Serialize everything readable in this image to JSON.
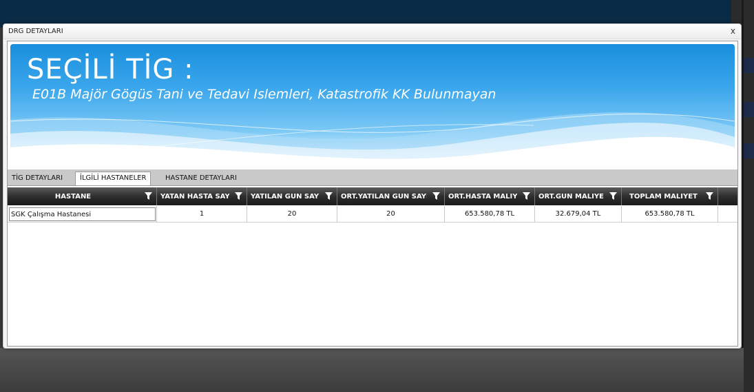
{
  "dialog": {
    "title": "DRG DETAYLARI",
    "close": "x"
  },
  "banner": {
    "heading": "SEÇİLİ TİG :",
    "subtitle": "E01B Majör Gögüs Tani ve Tedavi Islemleri, Katastrofik KK Bulunmayan"
  },
  "tabs": [
    {
      "label": "TİG DETAYLARI",
      "active": false
    },
    {
      "label": "İLGİLİ HASTANELER",
      "active": true
    },
    {
      "label": "HASTANE DETAYLARI",
      "active": false
    }
  ],
  "grid": {
    "columns": [
      "HASTANE",
      "YATAN HASTA SAYISI",
      "YATILAN GÜN SAYISI",
      "ORT.YATILAN GÜN SAYISI",
      "ORT.HASTA MALİYETİ",
      "ORT.GÜN MALİYETİ",
      "TOPLAM MALİYET"
    ],
    "rows": [
      [
        "SGK Çalışma Hastanesi",
        "1",
        "20",
        "20",
        "653.580,78 TL",
        "32.679,04 TL",
        "653.580,78 TL"
      ]
    ]
  },
  "colors": {
    "banner_blue": "#1a8fdd",
    "header_dark": "#2e2e2e"
  }
}
